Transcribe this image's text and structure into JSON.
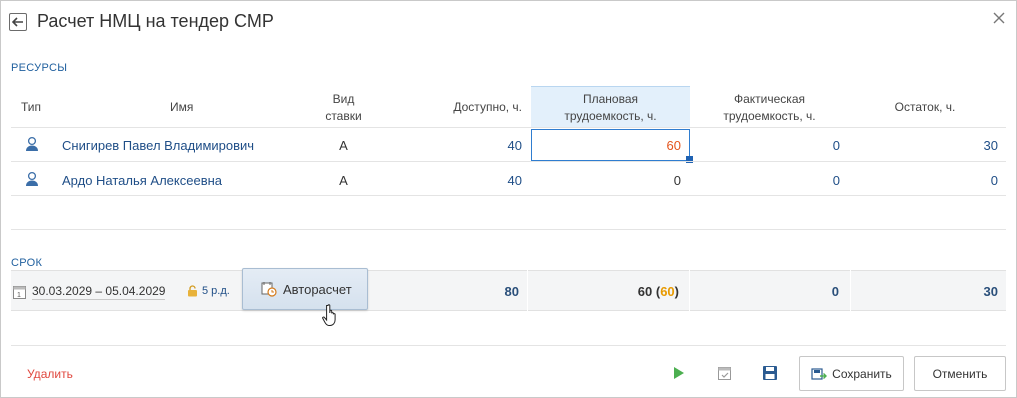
{
  "window": {
    "title": "Расчет НМЦ на тендер СМР"
  },
  "resources": {
    "section_label": "РЕСУРСЫ",
    "columns": {
      "type": "Тип",
      "name": "Имя",
      "rate_type_1": "Вид",
      "rate_type_2": "ставки",
      "available": "Доступно, ч.",
      "planned_1": "Плановая",
      "planned_2": "трудоемкость, ч.",
      "actual_1": "Фактическая",
      "actual_2": "трудоемкость, ч.",
      "remaining": "Остаток, ч."
    },
    "rows": [
      {
        "name": "Снигирев Павел Владимирович",
        "rate": "А",
        "available": "40",
        "planned": "60",
        "actual": "0",
        "remaining": "30"
      },
      {
        "name": "Ардо Наталья Алексеевна",
        "rate": "А",
        "available": "40",
        "planned": "0",
        "actual": "0",
        "remaining": "0"
      }
    ]
  },
  "term": {
    "section_label": "СРОК",
    "date_range": "30.03.2029 – 05.04.2029",
    "duration": "5 р.д.",
    "autocalc_label": "Авторасчет",
    "totals": {
      "available": "80",
      "planned": "60",
      "planned_paren_open": " (",
      "planned_extra": "60",
      "planned_paren_close": ")",
      "actual": "0",
      "remaining": "30"
    }
  },
  "footer": {
    "delete_label": "Удалить",
    "save_label": "Сохранить",
    "cancel_label": "Отменить"
  },
  "colors": {
    "accent": "#1f4e87",
    "highlight": "#e3f0fb",
    "edited_value": "#e4541c",
    "planned_extra": "#e89a00",
    "delete": "#e0473e",
    "run": "#4caf50"
  },
  "icons": {
    "back": "arrow-left-icon",
    "close": "close-icon",
    "resource_type": "person-icon",
    "calendar": "calendar-icon",
    "lock": "lock-icon",
    "autocalc": "calendar-clock-icon",
    "run": "play-icon",
    "schedule": "calendar-check-icon",
    "save": "floppy-disk-icon",
    "save_button": "save-export-icon"
  }
}
